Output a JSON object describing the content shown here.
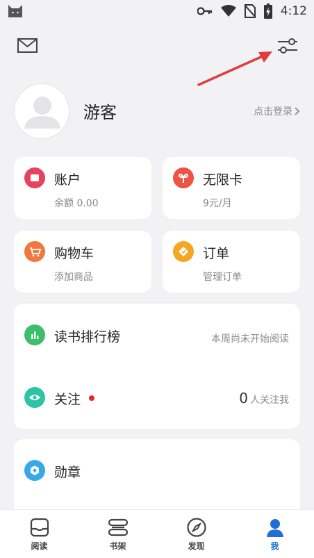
{
  "status_bar": {
    "time": "4:12"
  },
  "profile": {
    "username": "游客",
    "login_label": "点击登录"
  },
  "tiles": [
    {
      "title": "账户",
      "subtitle": "余额 0.00"
    },
    {
      "title": "无限卡",
      "subtitle": "9元/月"
    },
    {
      "title": "购物车",
      "subtitle": "添加商品"
    },
    {
      "title": "订单",
      "subtitle": "管理订单"
    }
  ],
  "stats": {
    "ranking": {
      "title": "读书排行榜",
      "status": "本周尚未开始阅读"
    },
    "follow": {
      "title": "关注",
      "count": "0",
      "suffix": "人关注我"
    }
  },
  "medals": {
    "title": "勋章"
  },
  "tabbar": [
    {
      "label": "阅读"
    },
    {
      "label": "书架"
    },
    {
      "label": "发现"
    },
    {
      "label": "我"
    }
  ],
  "colors": {
    "accent_blue": "#1f6fd6",
    "account_icon": "#e8415f",
    "card_icon": "#ef5346",
    "cart_icon": "#f2763d",
    "order_icon": "#f5a623",
    "ranking_icon": "#3bbf6a",
    "follow_icon": "#2fc3a5",
    "medal_icon": "#37a8e8",
    "notice_dot": "#e8262b"
  }
}
